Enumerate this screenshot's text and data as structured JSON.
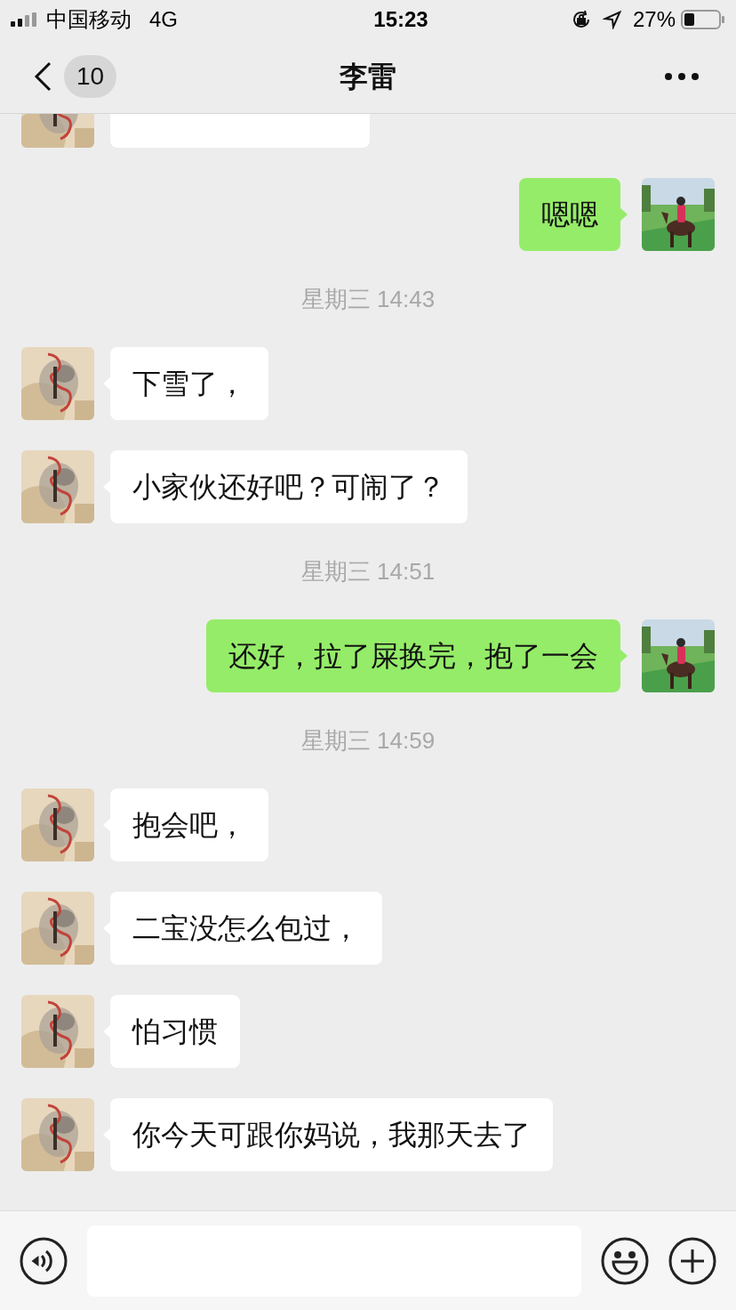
{
  "status_bar": {
    "carrier": "中国移动",
    "network": "4G",
    "time": "15:23",
    "battery": "27%"
  },
  "nav": {
    "unread": "10",
    "title": "李雷"
  },
  "messages": [
    {
      "kind": "clipped"
    },
    {
      "kind": "sent",
      "text": "嗯嗯"
    },
    {
      "kind": "time",
      "text": "星期三 14:43"
    },
    {
      "kind": "received",
      "text": "下雪了，"
    },
    {
      "kind": "received",
      "text": "小家伙还好吧？可闹了？"
    },
    {
      "kind": "time",
      "text": "星期三 14:51"
    },
    {
      "kind": "sent",
      "text": "还好，拉了屎换完，抱了一会"
    },
    {
      "kind": "time",
      "text": "星期三 14:59"
    },
    {
      "kind": "received",
      "text": "抱会吧，"
    },
    {
      "kind": "received",
      "text": "二宝没怎么包过，"
    },
    {
      "kind": "received",
      "text": "怕习惯"
    },
    {
      "kind": "received",
      "text": "你今天可跟你妈说，我那天去了"
    }
  ]
}
